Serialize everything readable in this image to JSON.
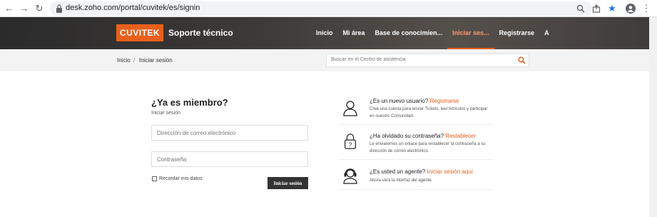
{
  "browser": {
    "url": "desk.zoho.com/portal/cuvitek/es/signin"
  },
  "header": {
    "logo_text": "CUVITEK",
    "brand": "Soporte técnico",
    "nav": [
      {
        "label": "Inicio"
      },
      {
        "label": "Mi área"
      },
      {
        "label": "Base de conocimien..."
      },
      {
        "label": "Iniciar ses..."
      },
      {
        "label": "Registrarse"
      },
      {
        "label": "A"
      }
    ],
    "active_index": 3
  },
  "breadcrumb": {
    "home": "Inicio",
    "separator": "/",
    "current": "Iniciar sesión"
  },
  "search": {
    "placeholder": "Buscar en el Centro de asistencia"
  },
  "login": {
    "title": "¿Ya es miembro?",
    "subtitle": "Iniciar sesión",
    "email_placeholder": "Dirección de correo electrónico",
    "password_placeholder": "Contraseña",
    "remember_label": "Recordar mis datos",
    "submit_label": "Iniciar sesión"
  },
  "panels": [
    {
      "icon": "user-icon",
      "question": "¿Es un nuevo usuario?",
      "link": "Registrarse",
      "description": "Cree una cuenta para enviar Tickets, leer Artículos y participar en nuestro Comunidad."
    },
    {
      "icon": "lock-question-icon",
      "question": "¿Ha olvidado su contraseña?",
      "link": "Restablecer",
      "description": "Le enviaremos un enlace para restablecer la contraseña a su dirección de correo electrónico."
    },
    {
      "icon": "agent-headset-icon",
      "question": "¿Es usted un agente?",
      "link": "Iniciar sesión aquí",
      "description": "Ahora verá la interfaz del agente."
    }
  ],
  "colors": {
    "accent": "#e8601c",
    "header_dark": "#2b2b2b",
    "button_dark": "#333333"
  }
}
